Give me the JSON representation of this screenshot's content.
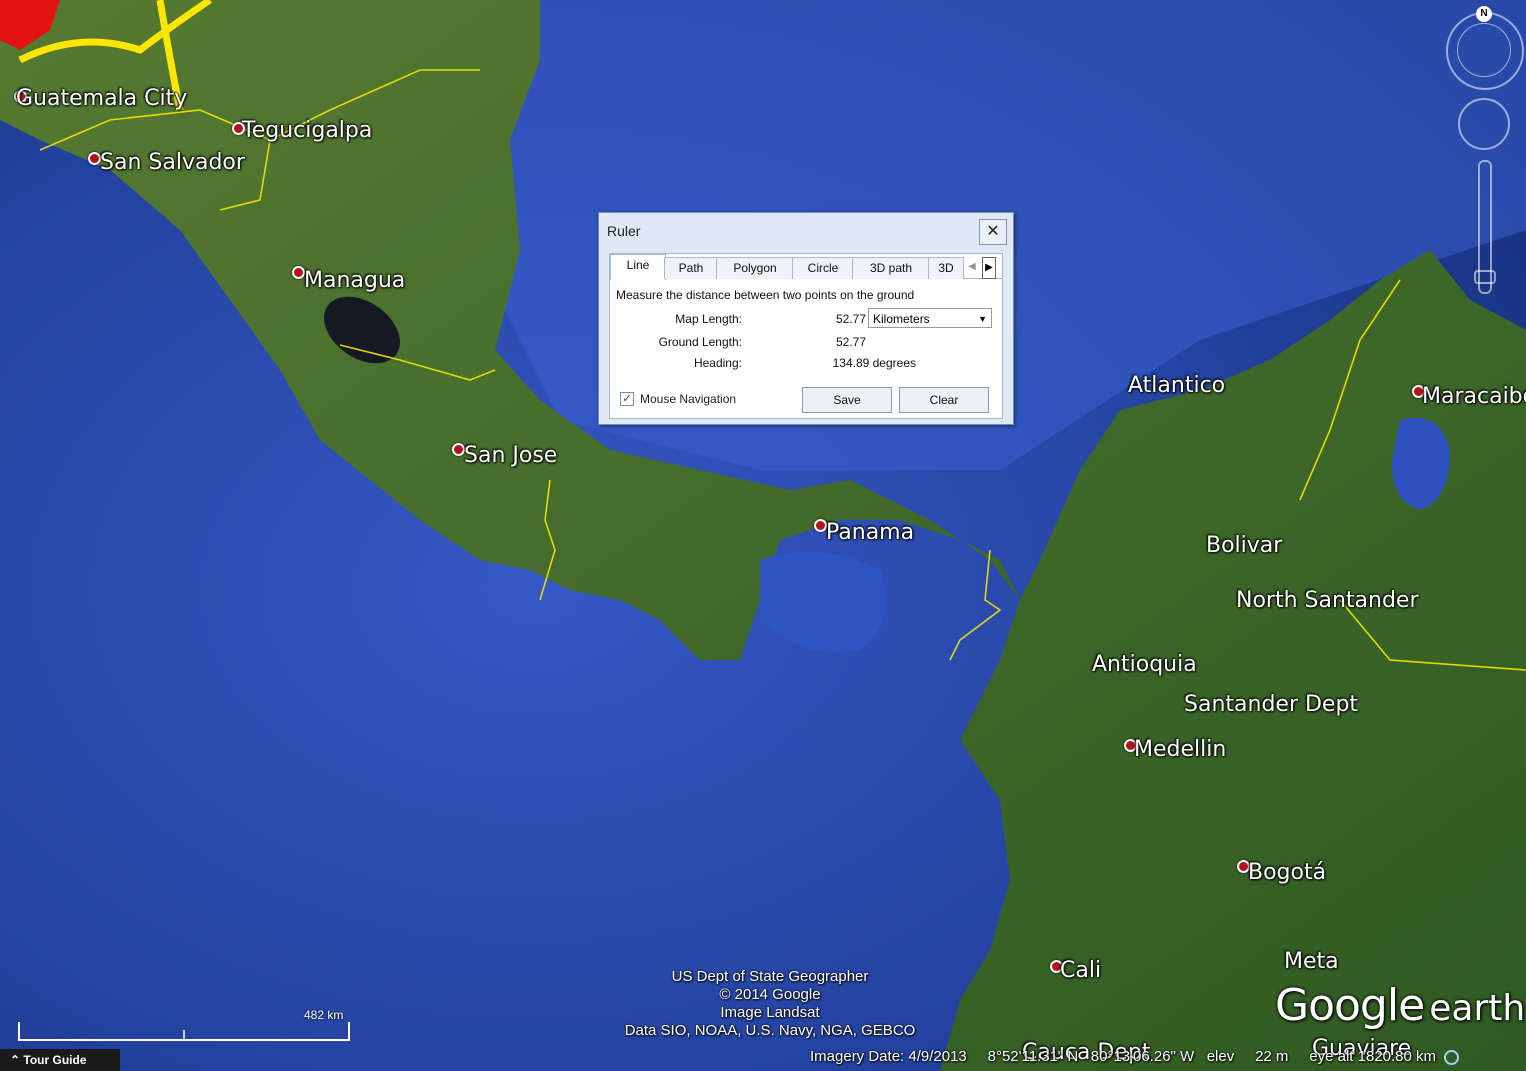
{
  "map": {
    "cities": [
      {
        "name": "Guatemala City",
        "pin": true
      },
      {
        "name": "Tegucigalpa",
        "pin": true
      },
      {
        "name": "San Salvador",
        "pin": true
      },
      {
        "name": "Managua",
        "pin": true
      },
      {
        "name": "San Jose",
        "pin": true
      },
      {
        "name": "Panama",
        "pin": true
      },
      {
        "name": "Atlantico",
        "pin": false
      },
      {
        "name": "Maracaibo",
        "pin": true
      },
      {
        "name": "Bolivar",
        "pin": false
      },
      {
        "name": "North Santander",
        "pin": false
      },
      {
        "name": "Antioquia",
        "pin": false
      },
      {
        "name": "Santander Dept",
        "pin": false
      },
      {
        "name": "Medellin",
        "pin": true
      },
      {
        "name": "Bogotá",
        "pin": true
      },
      {
        "name": "Cali",
        "pin": true
      },
      {
        "name": "Meta",
        "pin": false
      },
      {
        "name": "Cauca Dept",
        "pin": false
      },
      {
        "name": "Guaviare",
        "pin": false
      }
    ],
    "colors": {
      "ocean": "#2a49a8",
      "land": "#3f6b2a",
      "border": "#f2e600"
    }
  },
  "ruler": {
    "title": "Ruler",
    "close": "✕",
    "tabs": [
      "Line",
      "Path",
      "Polygon",
      "Circle",
      "3D path",
      "3D"
    ],
    "active_tab": "Line",
    "description": "Measure the distance between two points on the ground",
    "map_length_label": "Map Length:",
    "map_length_value": "52.77",
    "unit": "Kilometers",
    "ground_length_label": "Ground Length:",
    "ground_length_value": "52.77",
    "heading_label": "Heading:",
    "heading_value": "134.89 degrees",
    "mouse_navigation_label": "Mouse Navigation",
    "mouse_navigation_checked": true,
    "save_label": "Save",
    "clear_label": "Clear"
  },
  "nav": {
    "north_label": "N"
  },
  "credits": {
    "line1": "US Dept of State Geographer",
    "line2": "© 2014 Google",
    "line3": "Image Landsat",
    "line4": "Data SIO, NOAA, U.S. Navy, NGA, GEBCO"
  },
  "logo": {
    "google": "Google",
    "earth": "earth"
  },
  "scale": {
    "label": "482 km"
  },
  "tour_guide": "Tour Guide",
  "status": {
    "imagery_date": "Imagery Date: 4/9/2013",
    "lat": "8°52'11.31\" N",
    "lon": "80°13'06.26\" W",
    "elev_label": "elev",
    "elev": "22 m",
    "eye_alt": "eye alt 1820.80 km"
  }
}
